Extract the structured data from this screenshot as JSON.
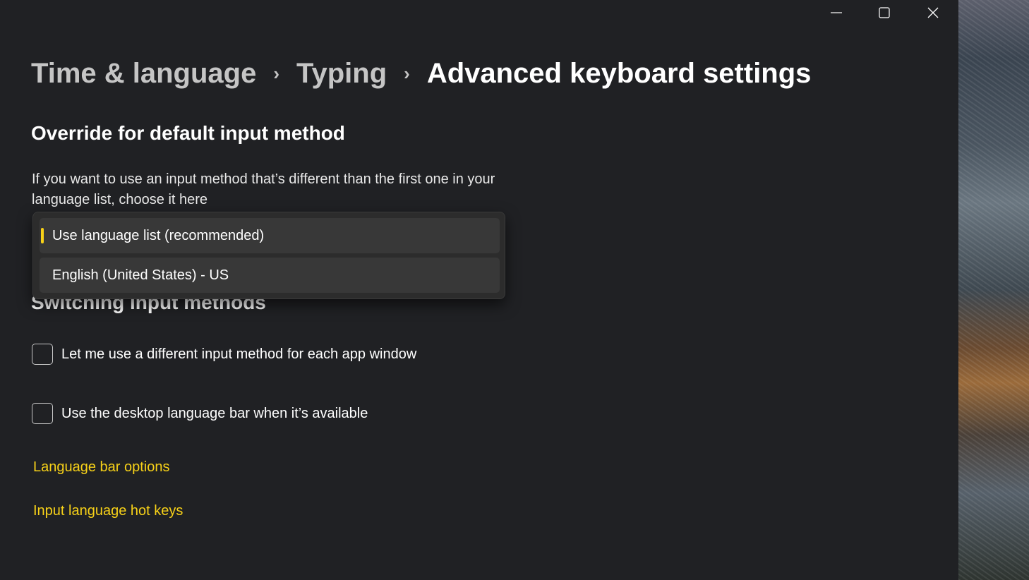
{
  "window": {
    "controls": [
      "minimize",
      "maximize",
      "close"
    ]
  },
  "breadcrumb": {
    "items": [
      "Time & language",
      "Typing",
      "Advanced keyboard settings"
    ]
  },
  "override": {
    "title": "Override for default input method",
    "description": "If you want to use an input method that’s different than the first one in your language list, choose it here",
    "options": [
      "Use language list (recommended)",
      "English (United States) - US"
    ],
    "selected": "Use language list (recommended)",
    "accent": "#f7d118"
  },
  "switching": {
    "title": "Switching input methods",
    "checkboxes": [
      {
        "label": "Let me use a different input method for each app window",
        "checked": false
      },
      {
        "label": "Use the desktop language bar when it’s available",
        "checked": false
      }
    ]
  },
  "links": [
    "Language bar options",
    "Input language hot keys"
  ]
}
